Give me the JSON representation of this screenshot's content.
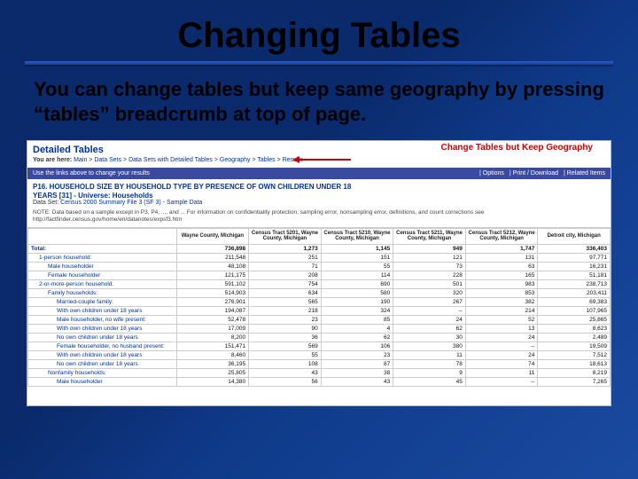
{
  "title": "Changing Tables",
  "body": "You can change tables but keep same geography by pressing “tables” breadcrumb at top of page.",
  "screenshot": {
    "detailed_label": "Detailed Tables",
    "you_are_here_label": "You are here:",
    "breadcrumb": [
      "Main",
      "Data Sets",
      "Data Sets with Detailed Tables",
      "Geography",
      "Tables",
      "Results"
    ],
    "callout": "Change Tables but Keep Geography",
    "changebar_left": "Use the links above to change your results",
    "changebar_right": [
      "| Options",
      "| Print / Download",
      "| Related Items"
    ],
    "table_title_line1": "P16. HOUSEHOLD SIZE BY HOUSEHOLD TYPE BY PRESENCE OF OWN CHILDREN UNDER 18",
    "table_title_line2": "YEARS [31] - Universe: Households",
    "data_set_label": "Data Set:",
    "data_set_value": "Census 2000 Summary File 3 (SF 3) - Sample Data",
    "note": "NOTE: Data based on a sample except in P3, P4, ..., and ... For information on confidentiality protection, sampling error, nonsampling error, definitions, and count corrections see http://factfinder.census.gov/home/en/datanotes/expsf3.htm",
    "columns": [
      "",
      "Wayne County, Michigan",
      "Census Tract 5201, Wayne County, Michigan",
      "Census Tract 5210, Wayne County, Michigan",
      "Census Tract 5211, Wayne County, Michigan",
      "Census Tract 5212, Wayne County, Michigan",
      "Detroit city, Michigan"
    ],
    "rows": [
      {
        "label": "Total:",
        "indent": 0,
        "total": true,
        "vals": [
          "736,898",
          "1,273",
          "1,145",
          "949",
          "1,747",
          "336,403"
        ]
      },
      {
        "label": "1-person household:",
        "indent": 1,
        "vals": [
          "211,548",
          "251",
          "151",
          "121",
          "131",
          "97,771"
        ]
      },
      {
        "label": "Male householder",
        "indent": 2,
        "vals": [
          "48,108",
          "71",
          "55",
          "73",
          "63",
          "16,231"
        ]
      },
      {
        "label": "Female householder",
        "indent": 2,
        "vals": [
          "121,175",
          "208",
          "114",
          "228",
          "165",
          "51,181"
        ]
      },
      {
        "label": "2-or-more-person household:",
        "indent": 1,
        "vals": [
          "591,102",
          "754",
          "690",
          "501",
          "983",
          "238,713"
        ]
      },
      {
        "label": "Family households:",
        "indent": 2,
        "vals": [
          "514,903",
          "634",
          "580",
          "320",
          "853",
          "203,411"
        ]
      },
      {
        "label": "Married-couple family:",
        "indent": 3,
        "vals": [
          "276,901",
          "565",
          "190",
          "267",
          "382",
          "69,383"
        ]
      },
      {
        "label": "With own children under 18 years",
        "indent": 3,
        "vals": [
          "194,087",
          "218",
          "324",
          "--",
          "214",
          "107,965"
        ]
      },
      {
        "label": "Male householder, no wife present:",
        "indent": 3,
        "vals": [
          "52,478",
          "23",
          "85",
          "24",
          "52",
          "25,865"
        ]
      },
      {
        "label": "With own children under 18 years",
        "indent": 3,
        "vals": [
          "17,009",
          "90",
          "4",
          "62",
          "13",
          "8,623"
        ]
      },
      {
        "label": "No own children under 18 years",
        "indent": 3,
        "vals": [
          "8,200",
          "36",
          "62",
          "30",
          "24",
          "2,489"
        ]
      },
      {
        "label": "Female householder, no husband present:",
        "indent": 3,
        "vals": [
          "151,471",
          "569",
          "106",
          "380",
          "--",
          "19,509"
        ]
      },
      {
        "label": "With own children under 18 years",
        "indent": 3,
        "vals": [
          "8,460",
          "55",
          "23",
          "11",
          "24",
          "7,512"
        ]
      },
      {
        "label": "No own children under 18 years",
        "indent": 3,
        "vals": [
          "36,195",
          "108",
          "87",
          "78",
          "74",
          "18,613"
        ]
      },
      {
        "label": "Nonfamily households:",
        "indent": 2,
        "vals": [
          "25,805",
          "43",
          "38",
          "9",
          "11",
          "8,219"
        ]
      },
      {
        "label": "Male householder",
        "indent": 3,
        "vals": [
          "14,380",
          "56",
          "43",
          "45",
          "--",
          "7,265"
        ]
      }
    ]
  }
}
